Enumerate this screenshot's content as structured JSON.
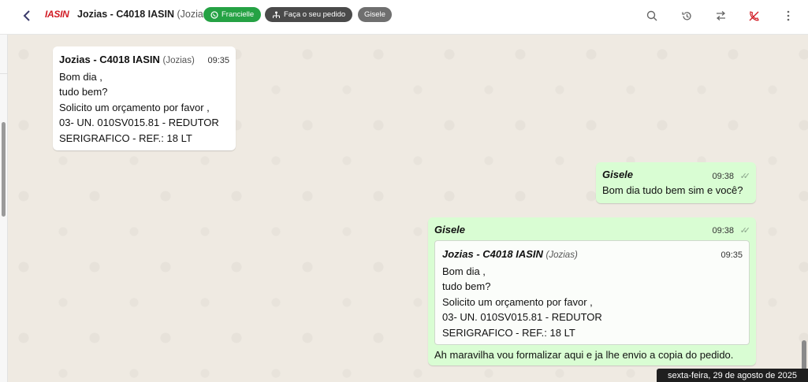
{
  "header": {
    "logo": "IASIN",
    "title": "Jozias - C4018 IASIN",
    "subtitle": "(Jozias)",
    "tags": {
      "whatsapp": "Francielle",
      "order": "Faça o seu pedido",
      "agent": "Gisele"
    }
  },
  "messages": {
    "incoming": {
      "sender": "Jozias - C4018 IASIN",
      "sender_sub": "(Jozias)",
      "time": "09:35",
      "lines": [
        "Bom dia ,",
        "tudo bem?",
        "Solicito um orçamento por favor ,",
        "03- UN. 010SV015.81 - REDUTOR",
        "SERIGRAFICO - REF.: 18 LT"
      ]
    },
    "reply1": {
      "sender": "Gisele",
      "time": "09:38",
      "text": "Bom dia tudo bem sim e você?"
    },
    "reply2": {
      "sender": "Gisele",
      "time": "09:38",
      "quote": {
        "sender": "Jozias - C4018 IASIN",
        "sender_sub": "(Jozias)",
        "time": "09:35",
        "lines": [
          "Bom dia ,",
          "tudo bem?",
          "Solicito um orçamento por favor ,",
          "03- UN. 010SV015.81 - REDUTOR",
          "SERIGRAFICO - REF.: 18 LT"
        ]
      },
      "text": "Ah maravilha vou formalizar aqui e ja lhe envio a copia do pedido."
    }
  },
  "date_separator": "sexta-feira, 29 de agosto de 2025",
  "colors": {
    "incoming": "#ffffff",
    "outgoing": "#d9fdd3",
    "whatsapp_green": "#25a244",
    "brand_red": "#d11b24"
  }
}
